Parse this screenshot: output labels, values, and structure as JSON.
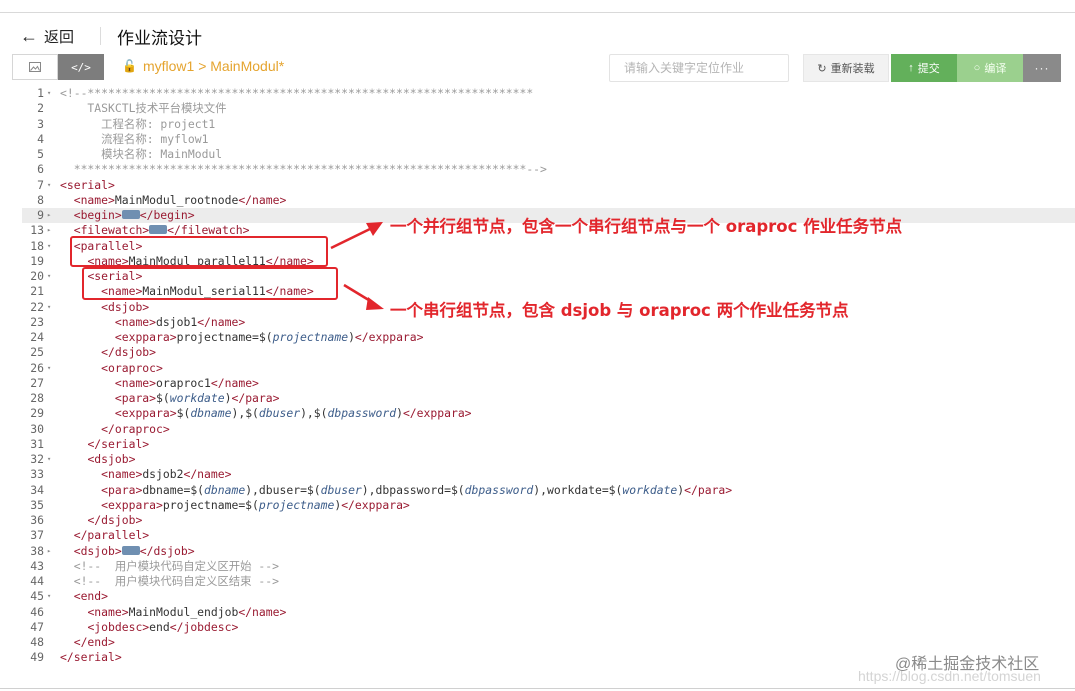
{
  "header": {
    "back_label": "返回",
    "title": "作业流设计"
  },
  "toolbar": {
    "breadcrumb": "myflow1 > MainModul*",
    "search_placeholder": "请输入关键字定位作业",
    "reload_label": "重新装载",
    "submit_label": "提交",
    "compile_label": "编译",
    "more_label": "···",
    "code_view_label": "</>"
  },
  "lines": [
    {
      "n": "1",
      "f": "▾",
      "s": [
        [
          "c",
          "<!--*****************************************************************"
        ]
      ]
    },
    {
      "n": "2",
      "f": "",
      "s": [
        [
          "c",
          "    TASKCTL技术平台模块文件"
        ]
      ]
    },
    {
      "n": "3",
      "f": "",
      "s": [
        [
          "c",
          "      工程名称: project1"
        ]
      ]
    },
    {
      "n": "4",
      "f": "",
      "s": [
        [
          "c",
          "      流程名称: myflow1"
        ]
      ]
    },
    {
      "n": "5",
      "f": "",
      "s": [
        [
          "c",
          "      模块名称: MainModul"
        ]
      ]
    },
    {
      "n": "6",
      "f": "",
      "s": [
        [
          "c",
          "  ******************************************************************-->"
        ]
      ]
    },
    {
      "n": "7",
      "f": "▾",
      "s": [
        [
          "t",
          "<serial>"
        ]
      ]
    },
    {
      "n": "8",
      "f": "",
      "s": [
        [
          "",
          "  "
        ],
        [
          "t",
          "<name>"
        ],
        [
          "",
          "MainModul_rootnode"
        ],
        [
          "t",
          "</name>"
        ]
      ]
    },
    {
      "n": "9",
      "f": "▸",
      "a": true,
      "s": [
        [
          "",
          "  "
        ],
        [
          "t",
          "<begin>"
        ],
        [
          "fb",
          ""
        ],
        [
          "t",
          "</begin>"
        ]
      ]
    },
    {
      "n": "13",
      "f": "▸",
      "s": [
        [
          "",
          "  "
        ],
        [
          "t",
          "<filewatch>"
        ],
        [
          "fb",
          ""
        ],
        [
          "t",
          "</filewatch>"
        ]
      ]
    },
    {
      "n": "18",
      "f": "▾",
      "s": [
        [
          "",
          "  "
        ],
        [
          "t",
          "<parallel>"
        ]
      ]
    },
    {
      "n": "19",
      "f": "",
      "s": [
        [
          "",
          "    "
        ],
        [
          "t",
          "<name>"
        ],
        [
          "",
          "MainModul_parallel11"
        ],
        [
          "t",
          "</name>"
        ]
      ]
    },
    {
      "n": "20",
      "f": "▾",
      "s": [
        [
          "",
          "    "
        ],
        [
          "t",
          "<serial>"
        ]
      ]
    },
    {
      "n": "21",
      "f": "",
      "s": [
        [
          "",
          "      "
        ],
        [
          "t",
          "<name>"
        ],
        [
          "",
          "MainModul_serial11"
        ],
        [
          "t",
          "</name>"
        ]
      ]
    },
    {
      "n": "22",
      "f": "▾",
      "s": [
        [
          "",
          "      "
        ],
        [
          "t",
          "<dsjob>"
        ]
      ]
    },
    {
      "n": "23",
      "f": "",
      "s": [
        [
          "",
          "        "
        ],
        [
          "t",
          "<name>"
        ],
        [
          "",
          "dsjob1"
        ],
        [
          "t",
          "</name>"
        ]
      ]
    },
    {
      "n": "24",
      "f": "",
      "s": [
        [
          "",
          "        "
        ],
        [
          "t",
          "<exppara>"
        ],
        [
          "",
          "projectname=$("
        ],
        [
          "v",
          "projectname"
        ],
        [
          "",
          ")"
        ],
        [
          "t",
          "</exppara>"
        ]
      ]
    },
    {
      "n": "25",
      "f": "",
      "s": [
        [
          "",
          "      "
        ],
        [
          "t",
          "</dsjob>"
        ]
      ]
    },
    {
      "n": "26",
      "f": "▾",
      "s": [
        [
          "",
          "      "
        ],
        [
          "t",
          "<oraproc>"
        ]
      ]
    },
    {
      "n": "27",
      "f": "",
      "s": [
        [
          "",
          "        "
        ],
        [
          "t",
          "<name>"
        ],
        [
          "",
          "oraproc1"
        ],
        [
          "t",
          "</name>"
        ]
      ]
    },
    {
      "n": "28",
      "f": "",
      "s": [
        [
          "",
          "        "
        ],
        [
          "t",
          "<para>"
        ],
        [
          "",
          "$("
        ],
        [
          "v",
          "workdate"
        ],
        [
          "",
          ")"
        ],
        [
          "t",
          "</para>"
        ]
      ]
    },
    {
      "n": "29",
      "f": "",
      "s": [
        [
          "",
          "        "
        ],
        [
          "t",
          "<exppara>"
        ],
        [
          "",
          "$("
        ],
        [
          "v",
          "dbname"
        ],
        [
          "",
          "),$("
        ],
        [
          "v",
          "dbuser"
        ],
        [
          "",
          "),$("
        ],
        [
          "v",
          "dbpassword"
        ],
        [
          "",
          ")"
        ],
        [
          "t",
          "</exppara>"
        ]
      ]
    },
    {
      "n": "30",
      "f": "",
      "s": [
        [
          "",
          "      "
        ],
        [
          "t",
          "</oraproc>"
        ]
      ]
    },
    {
      "n": "31",
      "f": "",
      "s": [
        [
          "",
          "    "
        ],
        [
          "t",
          "</serial>"
        ]
      ]
    },
    {
      "n": "32",
      "f": "▾",
      "s": [
        [
          "",
          "    "
        ],
        [
          "t",
          "<dsjob>"
        ]
      ]
    },
    {
      "n": "33",
      "f": "",
      "s": [
        [
          "",
          "      "
        ],
        [
          "t",
          "<name>"
        ],
        [
          "",
          "dsjob2"
        ],
        [
          "t",
          "</name>"
        ]
      ]
    },
    {
      "n": "34",
      "f": "",
      "s": [
        [
          "",
          "      "
        ],
        [
          "t",
          "<para>"
        ],
        [
          "",
          "dbname=$("
        ],
        [
          "v",
          "dbname"
        ],
        [
          "",
          "),dbuser=$("
        ],
        [
          "v",
          "dbuser"
        ],
        [
          "",
          "),dbpassword=$("
        ],
        [
          "v",
          "dbpassword"
        ],
        [
          "",
          "),workdate=$("
        ],
        [
          "v",
          "workdate"
        ],
        [
          "",
          ")"
        ],
        [
          "t",
          "</para>"
        ]
      ]
    },
    {
      "n": "35",
      "f": "",
      "s": [
        [
          "",
          "      "
        ],
        [
          "t",
          "<exppara>"
        ],
        [
          "",
          "projectname=$("
        ],
        [
          "v",
          "projectname"
        ],
        [
          "",
          ")"
        ],
        [
          "t",
          "</exppara>"
        ]
      ]
    },
    {
      "n": "36",
      "f": "",
      "s": [
        [
          "",
          "    "
        ],
        [
          "t",
          "</dsjob>"
        ]
      ]
    },
    {
      "n": "37",
      "f": "",
      "s": [
        [
          "",
          "  "
        ],
        [
          "t",
          "</parallel>"
        ]
      ]
    },
    {
      "n": "38",
      "f": "▸",
      "s": [
        [
          "",
          "  "
        ],
        [
          "t",
          "<dsjob>"
        ],
        [
          "fb",
          ""
        ],
        [
          "t",
          "</dsjob>"
        ]
      ]
    },
    {
      "n": "43",
      "f": "",
      "s": [
        [
          "c",
          "  <!--  用户模块代码自定义区开始 -->"
        ]
      ]
    },
    {
      "n": "44",
      "f": "",
      "s": [
        [
          "c",
          "  <!--  用户模块代码自定义区结束 -->"
        ]
      ]
    },
    {
      "n": "45",
      "f": "▾",
      "s": [
        [
          "",
          "  "
        ],
        [
          "t",
          "<end>"
        ]
      ]
    },
    {
      "n": "46",
      "f": "",
      "s": [
        [
          "",
          "    "
        ],
        [
          "t",
          "<name>"
        ],
        [
          "",
          "MainModul_endjob"
        ],
        [
          "t",
          "</name>"
        ]
      ]
    },
    {
      "n": "47",
      "f": "",
      "s": [
        [
          "",
          "    "
        ],
        [
          "t",
          "<jobdesc>"
        ],
        [
          "",
          "end"
        ],
        [
          "t",
          "</jobdesc>"
        ]
      ]
    },
    {
      "n": "48",
      "f": "",
      "s": [
        [
          "",
          "  "
        ],
        [
          "t",
          "</end>"
        ]
      ]
    },
    {
      "n": "49",
      "f": "",
      "s": [
        [
          "t",
          "</serial>"
        ]
      ]
    }
  ],
  "annotations": {
    "parallel_note": "一个并行组节点，包含一个串行组节点与一个 oraproc 作业任务节点",
    "serial_note": "一个串行组节点，包含 dsjob 与 oraproc 两个作业任务节点"
  },
  "watermark": {
    "primary": "@稀土掘金技术社区",
    "secondary": "https://blog.csdn.net/tomsuen"
  },
  "colors": {
    "annotation": "#e2262c",
    "tag": "#9a1b32",
    "variable": "#3d5d8a",
    "submit": "#63b05b",
    "breadcrumb": "#e5a42f"
  }
}
